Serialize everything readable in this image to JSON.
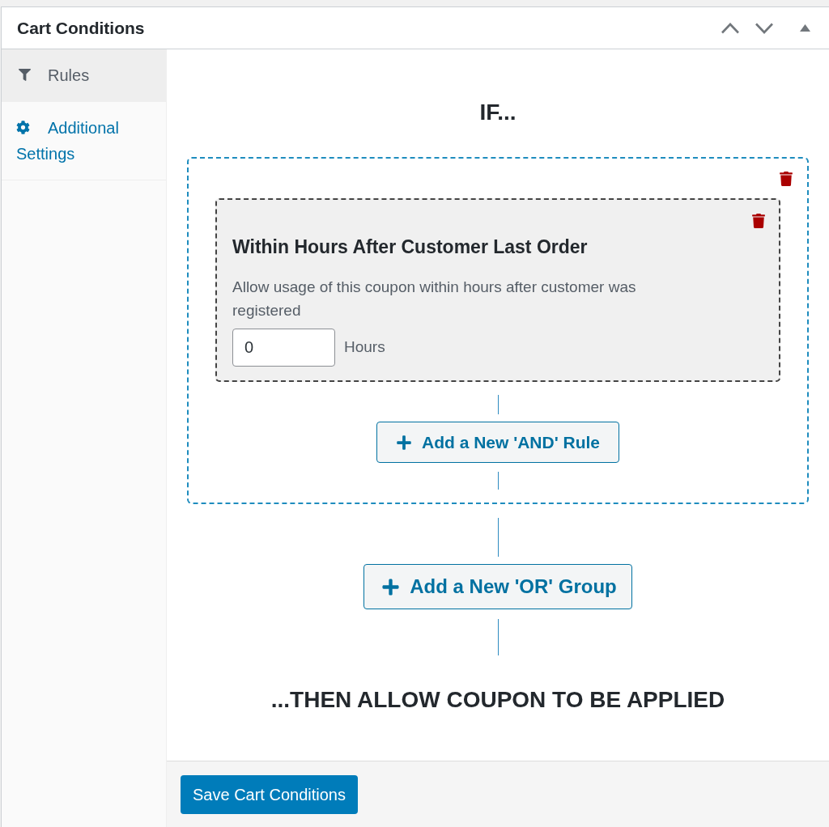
{
  "panel": {
    "title": "Cart Conditions"
  },
  "tabs": [
    {
      "label": "Rules",
      "selected": true
    },
    {
      "label": "Additional Settings",
      "selected": false
    }
  ],
  "conditions": {
    "heading": "IF...",
    "groups": [
      {
        "rules": [
          {
            "title": "Within Hours After Customer Last Order",
            "description": "Allow usage of this coupon within hours after customer was registered",
            "input": {
              "value": "0"
            },
            "unit": "Hours"
          }
        ],
        "add_rule_button": "Add a New 'AND' Rule"
      }
    ],
    "add_group_button": "Add a New 'OR' Group",
    "result": "...THEN ALLOW COUPON TO BE APPLIED"
  },
  "save_button": "Save Cart Conditions"
}
